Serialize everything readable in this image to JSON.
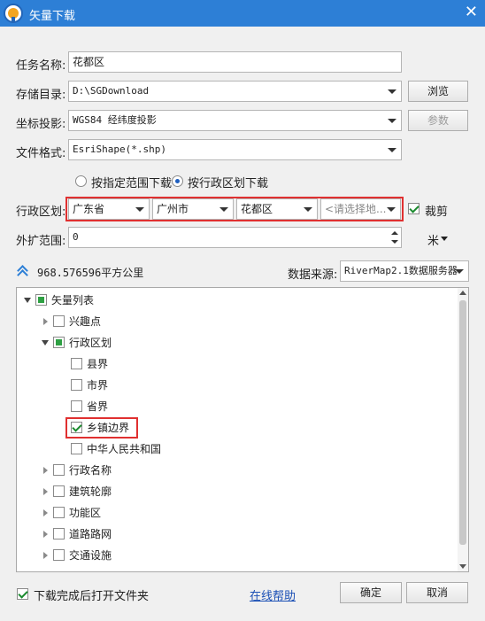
{
  "window": {
    "title": "矢量下载",
    "close": "✕"
  },
  "form": {
    "task_name_label": "任务名称:",
    "task_name_value": "花都区",
    "storage_label": "存储目录:",
    "storage_value": "D:\\SGDownload",
    "browse_label": "浏览",
    "projection_label": "坐标投影:",
    "projection_value": "WGS84 经纬度投影",
    "params_label": "参数",
    "format_label": "文件格式:",
    "format_value": "EsriShape(*.shp)",
    "radio_range_label": "按指定范围下载",
    "radio_admin_label": "按行政区划下载",
    "admin_label": "行政区划:",
    "province_value": "广东省",
    "city_value": "广州市",
    "district_value": "花都区",
    "town_placeholder": "<请选择地...",
    "clip_label": "裁剪",
    "expand_label": "外扩范围:",
    "expand_value": "0",
    "unit_value": "米",
    "area_text": "968.576596平方公里",
    "source_label": "数据来源:",
    "source_value": "RiverMap2.1数据服务器"
  },
  "tree": {
    "root": "矢量列表",
    "items": [
      {
        "label": "兴趣点"
      },
      {
        "label": "行政区划"
      },
      {
        "label": "县界"
      },
      {
        "label": "市界"
      },
      {
        "label": "省界"
      },
      {
        "label": "乡镇边界"
      },
      {
        "label": "中华人民共和国"
      },
      {
        "label": "行政名称"
      },
      {
        "label": "建筑轮廓"
      },
      {
        "label": "功能区"
      },
      {
        "label": "道路路网"
      },
      {
        "label": "交通设施"
      }
    ]
  },
  "footer": {
    "open_folder_label": "下载完成后打开文件夹",
    "help_link": "在线帮助",
    "ok_label": "确定",
    "cancel_label": "取消"
  },
  "colors": {
    "titlebar": "#2d7fd6",
    "highlight": "#e03030",
    "check": "#1a8a2e"
  }
}
